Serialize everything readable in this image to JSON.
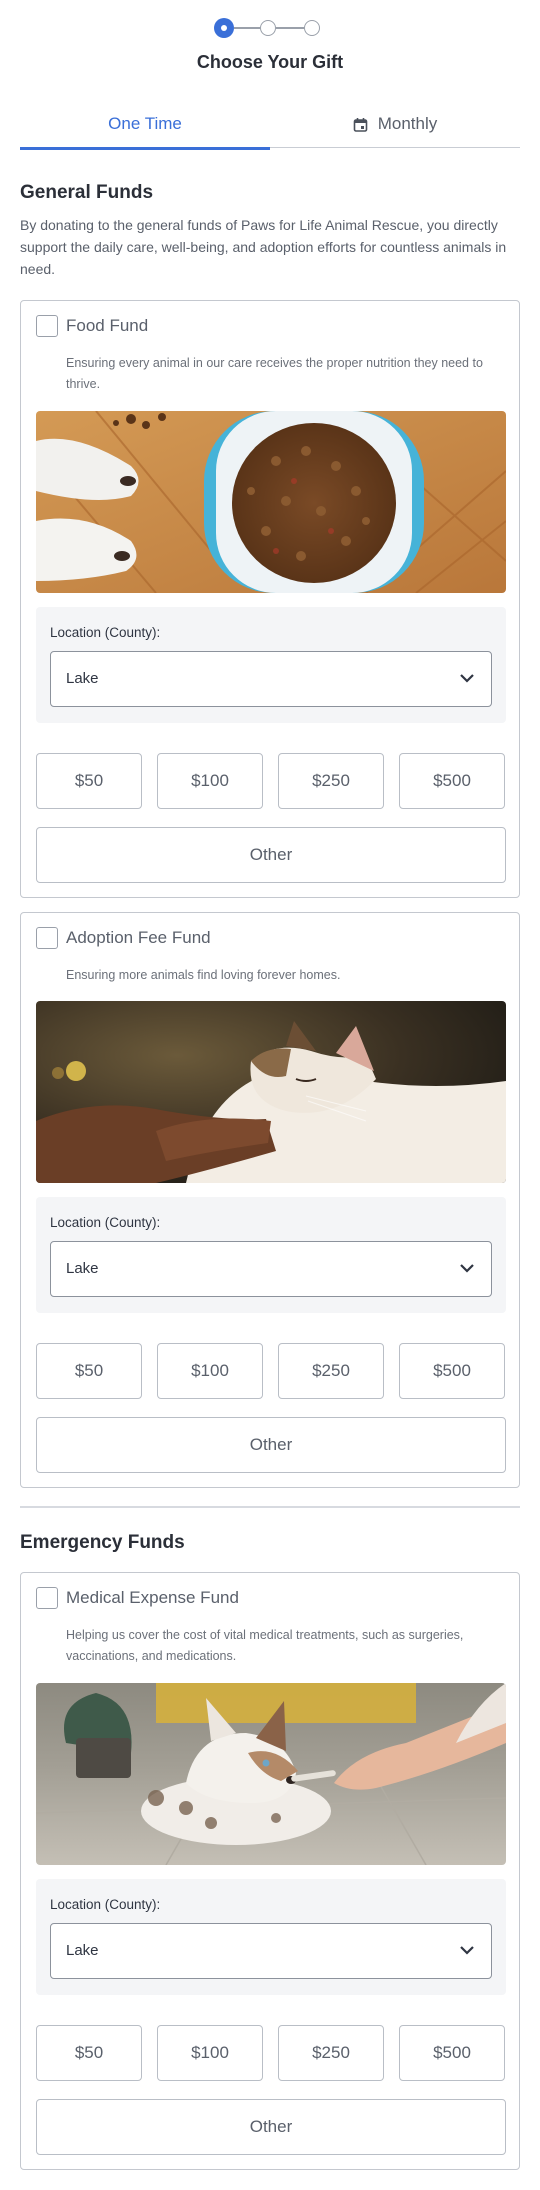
{
  "stepper": {
    "title": "Choose Your Gift",
    "current_step": 1,
    "total_steps": 3
  },
  "tabs": [
    {
      "label": "One Time",
      "active": true
    },
    {
      "label": "Monthly",
      "active": false,
      "icon": "calendar-icon"
    }
  ],
  "sections": [
    {
      "title": "General Funds",
      "description": "By donating to the general funds of Paws for Life Animal Rescue, you directly support the daily care, well-being, and adoption efforts for countless animals in need.",
      "funds": [
        {
          "title": "Food Fund",
          "description": "Ensuring every animal in our care receives the proper nutrition they need to thrive.",
          "image": "dog-paws-food-bowl-photo",
          "location_label": "Location (County):",
          "location_value": "Lake",
          "amounts": [
            "$50",
            "$100",
            "$250",
            "$500"
          ],
          "other_label": "Other"
        },
        {
          "title": "Adoption Fee Fund",
          "description": "Ensuring more animals find loving forever homes.",
          "image": "cat-being-petted-photo",
          "location_label": "Location (County):",
          "location_value": "Lake",
          "amounts": [
            "$50",
            "$100",
            "$250",
            "$500"
          ],
          "other_label": "Other"
        }
      ]
    },
    {
      "title": "Emergency Funds",
      "funds": [
        {
          "title": "Medical Expense Fund",
          "description": "Helping us cover the cost of vital medical treatments, such as surgeries, vaccinations, and medications.",
          "image": "puppy-receiving-medicine-photo",
          "location_label": "Location (County):",
          "location_value": "Lake",
          "amounts": [
            "$50",
            "$100",
            "$250",
            "$500"
          ],
          "other_label": "Other"
        }
      ]
    }
  ],
  "colors": {
    "accent": "#3a6fd8",
    "border": "#c4c8cf",
    "text": "#2f3542",
    "muted": "#5a606b",
    "panel": "#f4f5f7"
  }
}
